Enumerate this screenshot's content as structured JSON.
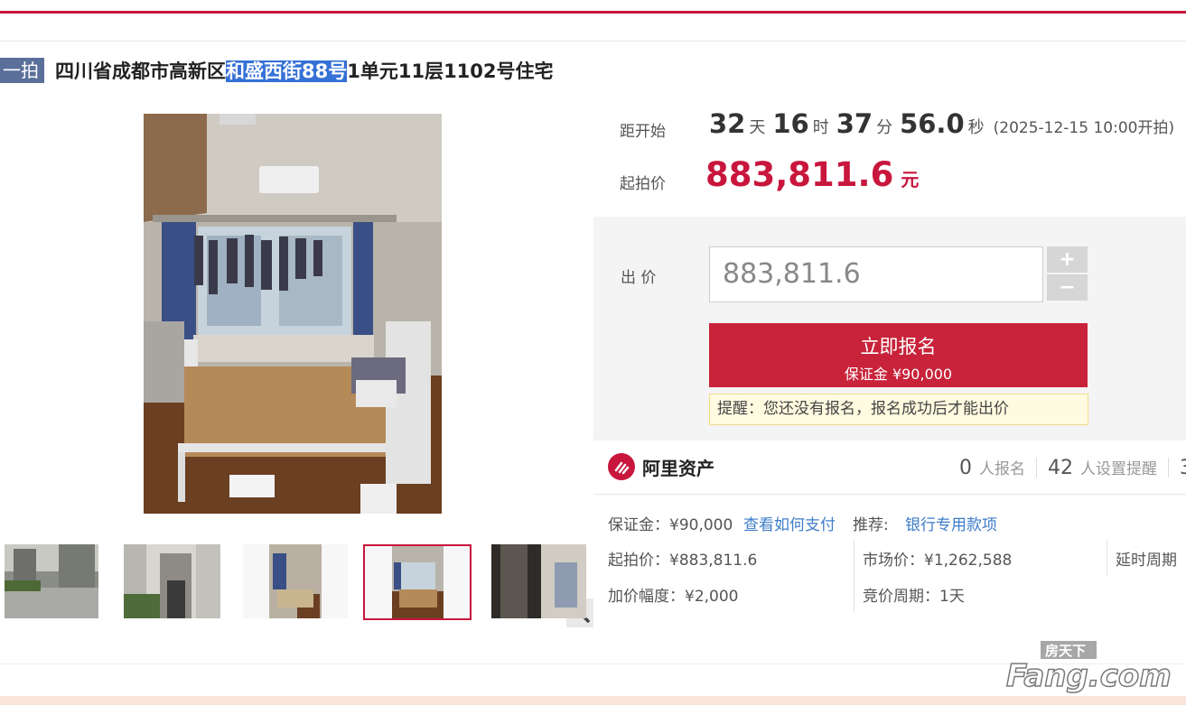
{
  "title": {
    "tag": "一拍",
    "prefix": "四川省成都市高新区",
    "highlight": "和盛西街88号",
    "suffix": "1单元11层1102号住宅"
  },
  "countdown": {
    "label": "距开始",
    "days": "32",
    "days_unit": "天",
    "hours": "16",
    "hours_unit": "时",
    "minutes": "37",
    "minutes_unit": "分",
    "seconds": "56.0",
    "seconds_unit": "秒",
    "start_time": "(2025-12-15 10:00开拍)"
  },
  "start_price": {
    "label": "起拍价",
    "value": "883,811.6",
    "unit": "元"
  },
  "bid": {
    "label": "出 价",
    "input_value": "883,811.6",
    "plus": "+",
    "minus": "−",
    "register_label": "立即报名",
    "deposit_label": "保证金 ¥90,000",
    "notice": "提醒：您还没有报名，报名成功后才能出价"
  },
  "brand": {
    "name": "阿里资产"
  },
  "stats": {
    "registered_count": "0",
    "registered_label": "人报名",
    "reminder_count": "42",
    "reminder_label": "人设置提醒",
    "cut_digit": "3"
  },
  "details": {
    "deposit": "保证金：¥90,000",
    "how_to_pay": "查看如何支付",
    "recommend_label": "推荐:",
    "recommend_link": "银行专用款项",
    "start_price": "起拍价：¥883,811.6",
    "market_price": "市场价：¥1,262,588",
    "delay_period": "延时周期",
    "increment": "加价幅度：¥2,000",
    "bid_period": "竞价周期：1天"
  },
  "watermark": {
    "top": "房天下",
    "main": "Fang.com"
  },
  "colors": {
    "accent": "#c8163d",
    "tag": "#5a6f9a",
    "link": "#3d7cc9"
  }
}
